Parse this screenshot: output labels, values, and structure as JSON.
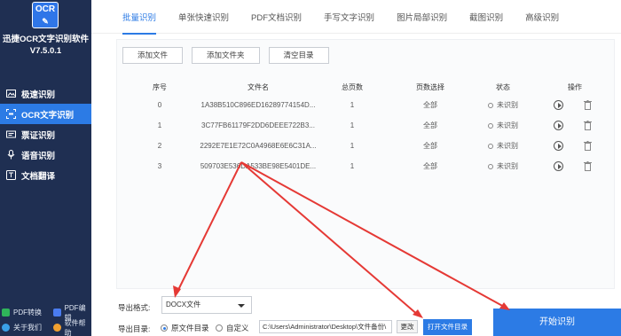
{
  "app": {
    "logo_text": "OCR",
    "title_line1": "迅捷OCR文字识别软件",
    "title_line2": "V7.5.0.1"
  },
  "sidebar": {
    "items": [
      {
        "label": "极速识别",
        "icon": "image-icon"
      },
      {
        "label": "OCR文字识别",
        "icon": "ocr-icon",
        "active": true
      },
      {
        "label": "票证识别",
        "icon": "ticket-icon"
      },
      {
        "label": "语音识别",
        "icon": "microphone-icon"
      },
      {
        "label": "文档翻译",
        "icon": "translate-icon"
      }
    ],
    "footer": [
      {
        "label": "PDF转换",
        "icon": "pdf-convert-icon"
      },
      {
        "label": "PDF编辑",
        "icon": "pdf-edit-icon"
      },
      {
        "label": "关于我们",
        "icon": "about-icon"
      },
      {
        "label": "软件帮助",
        "icon": "help-icon"
      }
    ]
  },
  "tabs": [
    {
      "label": "批量识别",
      "active": true
    },
    {
      "label": "单张快速识别"
    },
    {
      "label": "PDF文档识别"
    },
    {
      "label": "手写文字识别"
    },
    {
      "label": "图片局部识别"
    },
    {
      "label": "截图识别"
    },
    {
      "label": "高级识别"
    }
  ],
  "toolbar": {
    "add_file": "添加文件",
    "add_folder": "添加文件夹",
    "clear_list": "清空目录"
  },
  "table": {
    "headers": {
      "index": "序号",
      "filename": "文件名",
      "pages": "总页数",
      "page_select": "页数选择",
      "status": "状态",
      "actions": "操作"
    },
    "rows": [
      {
        "index": "0",
        "filename": "1A38B510C896ED16289774154D...",
        "pages": "1",
        "page_select": "全部",
        "status": "未识别"
      },
      {
        "index": "1",
        "filename": "3C77FB61179F2DD6DEEE722B3...",
        "pages": "1",
        "page_select": "全部",
        "status": "未识别"
      },
      {
        "index": "2",
        "filename": "2292E7E1E72C0A4968E6E6C31A...",
        "pages": "1",
        "page_select": "全部",
        "status": "未识别"
      },
      {
        "index": "3",
        "filename": "509703E536DA533BE98E5401DE...",
        "pages": "1",
        "page_select": "全部",
        "status": "未识别"
      }
    ]
  },
  "export": {
    "format_label": "导出格式:",
    "format_value": "DOCX文件",
    "dir_label": "导出目录:",
    "option_source": "原文件目录",
    "option_custom": "自定义",
    "path": "C:\\Users\\Administrator\\Desktop\\文件备份\\",
    "change_label": "更改",
    "open_label": "打开文件目录",
    "start_label": "开始识别"
  },
  "colors": {
    "accent": "#2c7be5",
    "sidebar_bg": "#1f2f52",
    "annotation": "#e53935"
  }
}
